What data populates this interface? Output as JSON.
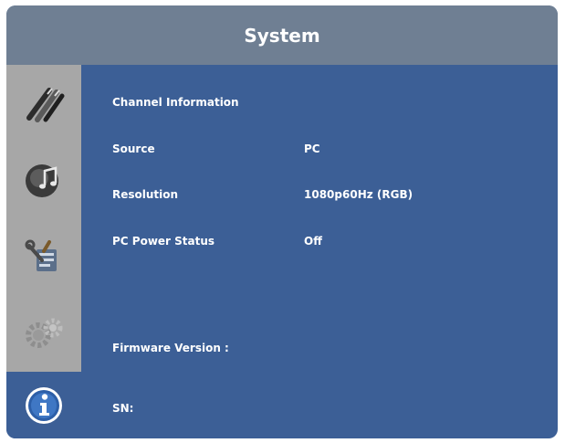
{
  "window": {
    "title": "System"
  },
  "sidebar": {
    "tabs": [
      {
        "icon": "adjust-tools-icon",
        "selected": false
      },
      {
        "icon": "audio-music-icon",
        "selected": false
      },
      {
        "icon": "setup-tools-icon",
        "selected": false
      },
      {
        "icon": "gears-icon",
        "selected": false
      },
      {
        "icon": "info-icon",
        "selected": true
      }
    ]
  },
  "info": {
    "heading": "Channel Information",
    "rows": [
      {
        "label": "Source",
        "value": "PC"
      },
      {
        "label": "Resolution",
        "value": "1080p60Hz (RGB)"
      },
      {
        "label": "PC Power Status",
        "value": "Off"
      }
    ],
    "firmware_label": "Firmware Version :",
    "sn_label": "SN:"
  },
  "colors": {
    "panel": "#3c5f96",
    "title_bar": "#6f7f93",
    "sidebar": "#a7a7a7",
    "text": "#ffffff"
  }
}
